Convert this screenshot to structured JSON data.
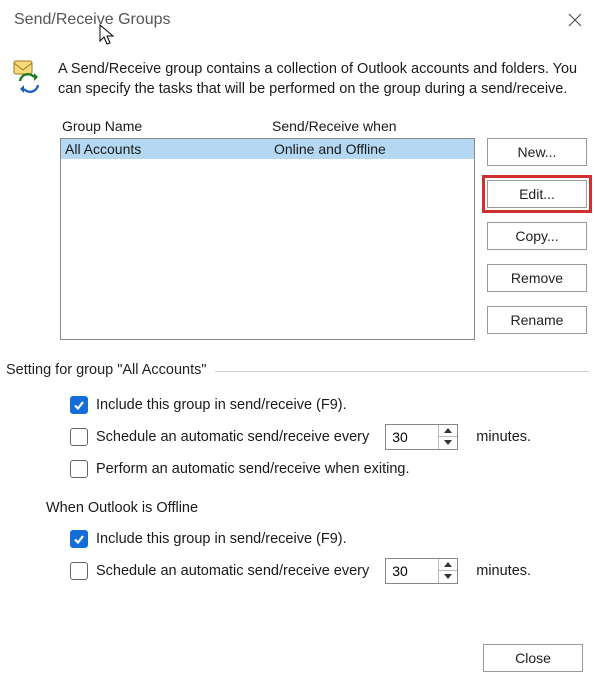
{
  "title": "Send/Receive Groups",
  "intro": "A Send/Receive group contains a collection of Outlook accounts and folders. You can specify the tasks that will be performed on the group during a send/receive.",
  "list": {
    "headers": {
      "name": "Group Name",
      "when": "Send/Receive when"
    },
    "rows": [
      {
        "name": "All Accounts",
        "when": "Online and Offline"
      }
    ]
  },
  "buttons": {
    "new": "New...",
    "edit": "Edit...",
    "copy": "Copy...",
    "remove": "Remove",
    "rename": "Rename",
    "close": "Close"
  },
  "section_label": "Setting for group \"All Accounts\"",
  "settings": {
    "include_online": "Include this group in send/receive (F9).",
    "schedule_online": "Schedule an automatic send/receive every",
    "schedule_online_value": "30",
    "perform_exit": "Perform an automatic send/receive when exiting.",
    "offline_heading": "When Outlook is Offline",
    "include_offline": "Include this group in send/receive (F9).",
    "schedule_offline": "Schedule an automatic send/receive every",
    "schedule_offline_value": "30",
    "unit": "minutes."
  }
}
